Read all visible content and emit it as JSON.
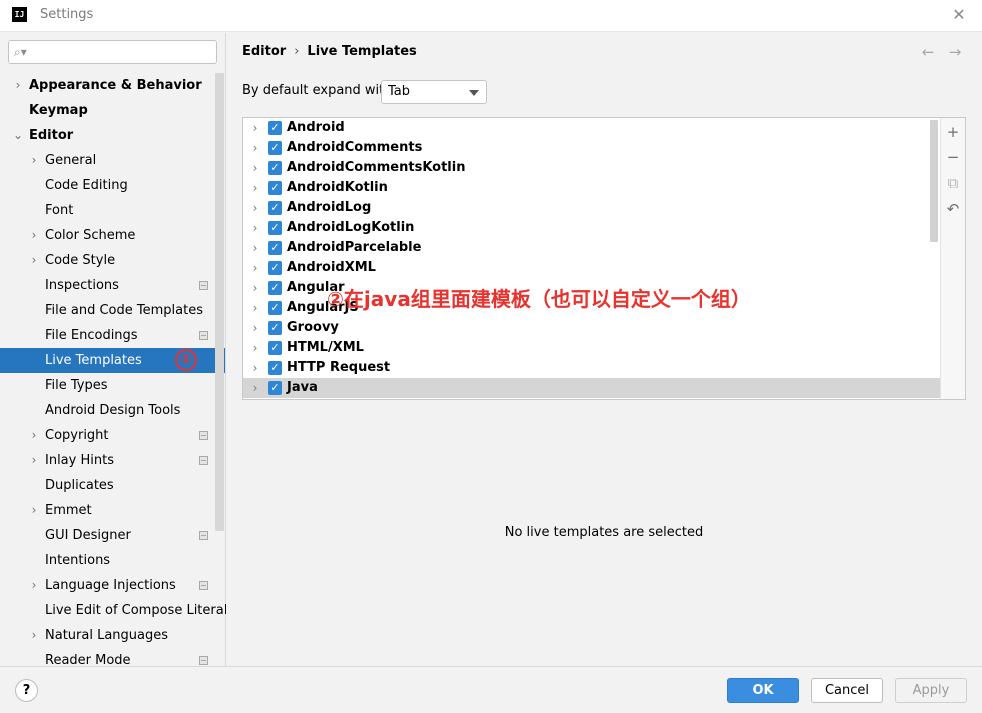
{
  "window": {
    "title": "Settings",
    "logo_text": "IJ",
    "close_label": "✕"
  },
  "search": {
    "placeholder": "",
    "icon": "search-icon"
  },
  "sidebar": {
    "items": [
      {
        "label": "Appearance & Behavior",
        "level": 0,
        "expandable": true,
        "expanded": false,
        "project_icon": false,
        "selected": false
      },
      {
        "label": "Keymap",
        "level": 0,
        "expandable": false,
        "expanded": false,
        "project_icon": false,
        "selected": false
      },
      {
        "label": "Editor",
        "level": 0,
        "expandable": true,
        "expanded": true,
        "project_icon": false,
        "selected": false
      },
      {
        "label": "General",
        "level": 1,
        "expandable": true,
        "expanded": false,
        "project_icon": false,
        "selected": false
      },
      {
        "label": "Code Editing",
        "level": 1,
        "expandable": false,
        "expanded": false,
        "project_icon": false,
        "selected": false
      },
      {
        "label": "Font",
        "level": 1,
        "expandable": false,
        "expanded": false,
        "project_icon": false,
        "selected": false
      },
      {
        "label": "Color Scheme",
        "level": 1,
        "expandable": true,
        "expanded": false,
        "project_icon": false,
        "selected": false
      },
      {
        "label": "Code Style",
        "level": 1,
        "expandable": true,
        "expanded": false,
        "project_icon": false,
        "selected": false
      },
      {
        "label": "Inspections",
        "level": 1,
        "expandable": false,
        "expanded": false,
        "project_icon": true,
        "selected": false
      },
      {
        "label": "File and Code Templates",
        "level": 1,
        "expandable": false,
        "expanded": false,
        "project_icon": false,
        "selected": false
      },
      {
        "label": "File Encodings",
        "level": 1,
        "expandable": false,
        "expanded": false,
        "project_icon": true,
        "selected": false
      },
      {
        "label": "Live Templates",
        "level": 1,
        "expandable": false,
        "expanded": false,
        "project_icon": false,
        "selected": true
      },
      {
        "label": "File Types",
        "level": 1,
        "expandable": false,
        "expanded": false,
        "project_icon": false,
        "selected": false
      },
      {
        "label": "Android Design Tools",
        "level": 1,
        "expandable": false,
        "expanded": false,
        "project_icon": false,
        "selected": false
      },
      {
        "label": "Copyright",
        "level": 1,
        "expandable": true,
        "expanded": false,
        "project_icon": true,
        "selected": false
      },
      {
        "label": "Inlay Hints",
        "level": 1,
        "expandable": true,
        "expanded": false,
        "project_icon": true,
        "selected": false
      },
      {
        "label": "Duplicates",
        "level": 1,
        "expandable": false,
        "expanded": false,
        "project_icon": false,
        "selected": false
      },
      {
        "label": "Emmet",
        "level": 1,
        "expandable": true,
        "expanded": false,
        "project_icon": false,
        "selected": false
      },
      {
        "label": "GUI Designer",
        "level": 1,
        "expandable": false,
        "expanded": false,
        "project_icon": true,
        "selected": false
      },
      {
        "label": "Intentions",
        "level": 1,
        "expandable": false,
        "expanded": false,
        "project_icon": false,
        "selected": false
      },
      {
        "label": "Language Injections",
        "level": 1,
        "expandable": true,
        "expanded": false,
        "project_icon": true,
        "selected": false
      },
      {
        "label": "Live Edit of Compose Literal",
        "level": 1,
        "expandable": false,
        "expanded": false,
        "project_icon": false,
        "selected": false
      },
      {
        "label": "Natural Languages",
        "level": 1,
        "expandable": true,
        "expanded": false,
        "project_icon": false,
        "selected": false
      },
      {
        "label": "Reader Mode",
        "level": 1,
        "expandable": false,
        "expanded": false,
        "project_icon": true,
        "selected": false
      }
    ],
    "annotation": "①"
  },
  "header": {
    "breadcrumb": [
      "Editor",
      "Live Templates"
    ],
    "back_icon": "arrow-left-icon",
    "forward_icon": "arrow-right-icon"
  },
  "expand_with": {
    "label": "By default expand with",
    "value": "Tab"
  },
  "templates": {
    "groups": [
      {
        "name": "Android",
        "checked": true,
        "highlighted": false
      },
      {
        "name": "AndroidComments",
        "checked": true,
        "highlighted": false
      },
      {
        "name": "AndroidCommentsKotlin",
        "checked": true,
        "highlighted": false
      },
      {
        "name": "AndroidKotlin",
        "checked": true,
        "highlighted": false
      },
      {
        "name": "AndroidLog",
        "checked": true,
        "highlighted": false
      },
      {
        "name": "AndroidLogKotlin",
        "checked": true,
        "highlighted": false
      },
      {
        "name": "AndroidParcelable",
        "checked": true,
        "highlighted": false
      },
      {
        "name": "AndroidXML",
        "checked": true,
        "highlighted": false
      },
      {
        "name": "Angular",
        "checked": true,
        "highlighted": false
      },
      {
        "name": "AngularJS",
        "checked": true,
        "highlighted": false
      },
      {
        "name": "Groovy",
        "checked": true,
        "highlighted": false
      },
      {
        "name": "HTML/XML",
        "checked": true,
        "highlighted": false
      },
      {
        "name": "HTTP Request",
        "checked": true,
        "highlighted": false
      },
      {
        "name": "Java",
        "checked": true,
        "highlighted": true
      }
    ],
    "toolbar": [
      {
        "icon": "add-icon",
        "glyph": "+"
      },
      {
        "icon": "remove-icon",
        "glyph": "−"
      },
      {
        "icon": "copy-icon",
        "glyph": "⧉"
      },
      {
        "icon": "restore-icon",
        "glyph": "↶"
      }
    ],
    "annotation": "②在java组里面建模板（也可以自定义一个组）"
  },
  "details": {
    "empty_message": "No live templates are selected"
  },
  "footer": {
    "help_label": "?",
    "ok_label": "OK",
    "cancel_label": "Cancel",
    "apply_label": "Apply"
  },
  "colors": {
    "accent": "#2675bf",
    "annotation": "#e8322d",
    "checkbox": "#2f86d6"
  }
}
